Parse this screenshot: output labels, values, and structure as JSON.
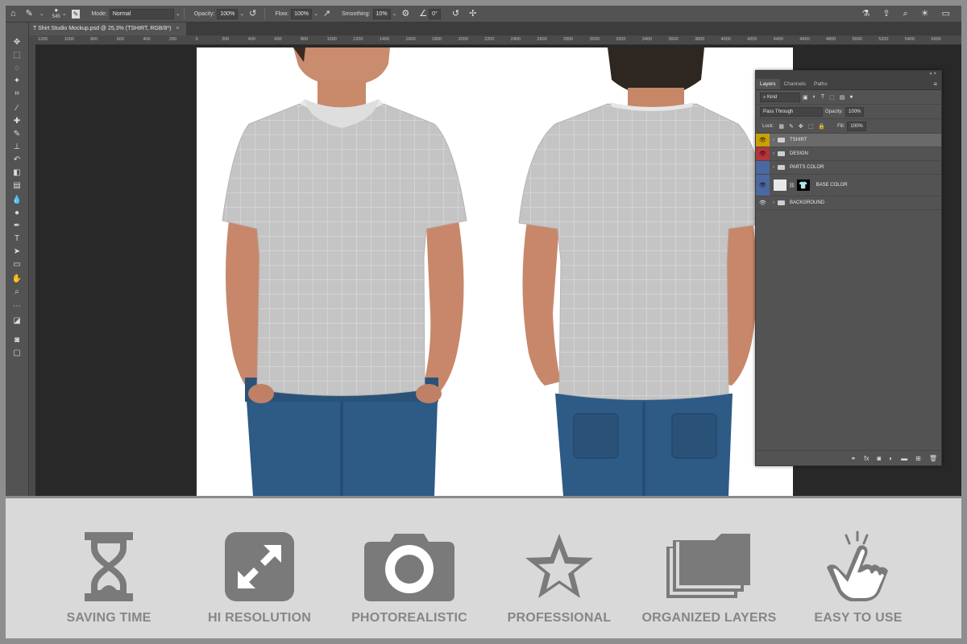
{
  "options_bar": {
    "brush_size": "545",
    "mode_label": "Mode:",
    "mode_value": "Normal",
    "opacity_label": "Opacity:",
    "opacity_value": "100%",
    "flow_label": "Flow:",
    "flow_value": "100%",
    "smoothing_label": "Smoothing:",
    "smoothing_value": "10%",
    "angle_value": "0°"
  },
  "document_tab": {
    "title": "T Shirt Studio Mockup.psd @ 25,3% (TSHIRT, RGB/8*)"
  },
  "ruler_ticks": [
    "1200",
    "1000",
    "800",
    "600",
    "400",
    "200",
    "0",
    "200",
    "400",
    "600",
    "800",
    "1000",
    "1200",
    "1400",
    "1600",
    "1800",
    "2000",
    "2200",
    "2400",
    "2600",
    "2800",
    "3000",
    "3200",
    "3400",
    "3600",
    "3800",
    "4000",
    "4200",
    "4400",
    "4600",
    "4800",
    "5000",
    "5200",
    "5400",
    "5600"
  ],
  "layers_panel": {
    "tabs": [
      "Layers",
      "Channels",
      "Paths"
    ],
    "filter_label": "Kind",
    "blend_mode": "Pass Through",
    "opacity_label": "Opacity:",
    "opacity_value": "100%",
    "lock_label": "Lock:",
    "fill_label": "Fill:",
    "fill_value": "100%",
    "layers": [
      {
        "name": "TSHIRT",
        "eye_color": "#c9a100"
      },
      {
        "name": "DESIGN",
        "eye_color": "#b6333a"
      },
      {
        "name": "PARTS COLOR",
        "eye_color": "#4b68a0"
      },
      {
        "name": "BASE COLOR",
        "eye_color": "#4b68a0"
      },
      {
        "name": "BACKGROUND",
        "eye_color": "#535353"
      }
    ]
  },
  "features": [
    {
      "label": "SAVING TIME",
      "icon": "hourglass-icon"
    },
    {
      "label": "HI RESOLUTION",
      "icon": "expand-icon"
    },
    {
      "label": "PHOTOREALISTIC",
      "icon": "camera-icon"
    },
    {
      "label": "PROFESSIONAL",
      "icon": "star-icon"
    },
    {
      "label": "ORGANIZED LAYERS",
      "icon": "folders-icon"
    },
    {
      "label": "EASY TO USE",
      "icon": "tap-icon"
    }
  ],
  "colors": {
    "icon_gray": "#7a7a7a",
    "strip_bg": "#d9d9d9",
    "tshirt_gray": "#c4c4c4"
  }
}
